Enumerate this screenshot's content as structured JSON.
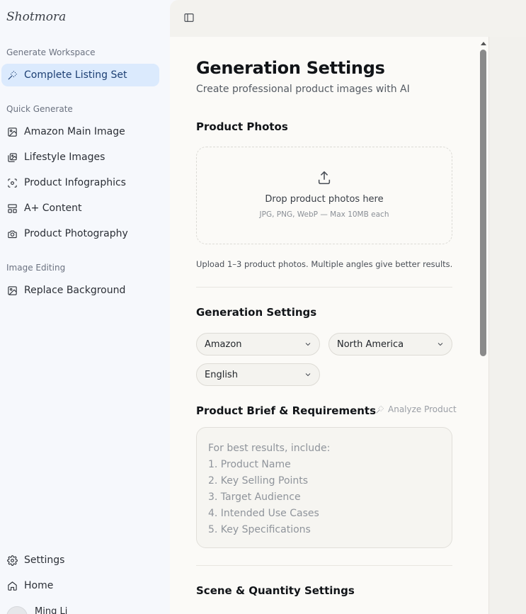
{
  "app": {
    "logo": "Shotmora"
  },
  "sidebar": {
    "sections": [
      {
        "label": "Generate Workspace"
      },
      {
        "label": "Quick Generate"
      },
      {
        "label": "Image Editing"
      }
    ],
    "items": [
      {
        "label": "Complete Listing Set",
        "icon": "magic-wand-icon",
        "active": true
      },
      {
        "label": "Amazon Main Image",
        "icon": "image-icon"
      },
      {
        "label": "Lifestyle Images",
        "icon": "images-icon"
      },
      {
        "label": "Product Infographics",
        "icon": "scan-icon"
      },
      {
        "label": "A+ Content",
        "icon": "layout-icon"
      },
      {
        "label": "Product Photography",
        "icon": "camera-icon"
      },
      {
        "label": "Replace Background",
        "icon": "image-icon"
      }
    ],
    "footer": [
      {
        "label": "Settings",
        "icon": "gear-icon"
      },
      {
        "label": "Home",
        "icon": "home-icon"
      }
    ],
    "user": {
      "name": "Ming Li"
    }
  },
  "main": {
    "title": "Generation Settings",
    "subtitle": "Create professional product images with AI",
    "photos": {
      "heading": "Product Photos",
      "drop_title": "Drop product photos here",
      "drop_hint": "JPG, PNG, WebP — Max 10MB each",
      "note": "Upload 1–3 product photos. Multiple angles give better results."
    },
    "settings": {
      "heading": "Generation Settings",
      "platform": "Amazon",
      "region": "North America",
      "language": "English"
    },
    "brief": {
      "heading": "Product Brief & Requirements",
      "analyze_label": "Analyze Product",
      "placeholder": "For best results, include:\n1. Product Name\n2. Key Selling Points\n3. Target Audience\n4. Intended Use Cases\n5. Key Specifications"
    },
    "scene": {
      "heading": "Scene & Quantity Settings"
    }
  }
}
